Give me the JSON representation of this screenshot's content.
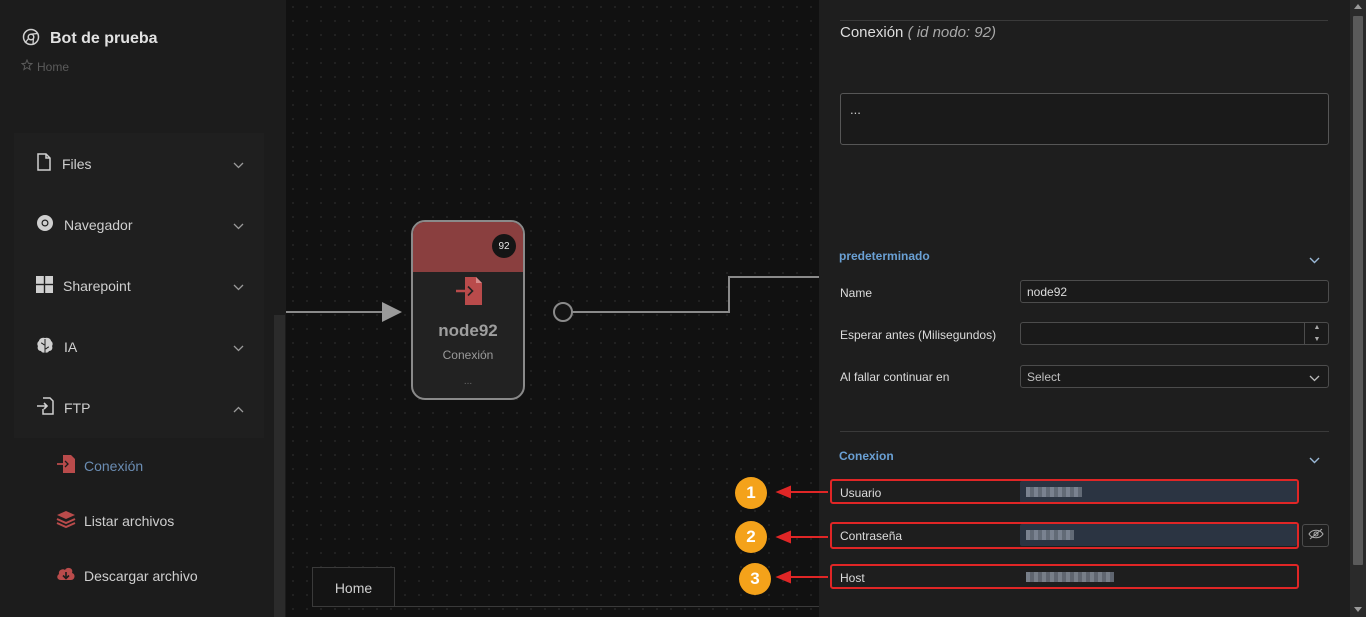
{
  "sidebar": {
    "brand": "Bot de prueba",
    "breadcrumb": "Home",
    "items": [
      {
        "label": "Files",
        "icon": "file-icon"
      },
      {
        "label": "Navegador",
        "icon": "chrome-icon"
      },
      {
        "label": "Sharepoint",
        "icon": "windows-icon"
      },
      {
        "label": "IA",
        "icon": "brain-icon"
      },
      {
        "label": "FTP",
        "icon": "login-icon"
      }
    ],
    "sub_items": [
      {
        "label": "Conexión",
        "icon": "login-icon",
        "active": true
      },
      {
        "label": "Listar archivos",
        "icon": "layers-icon"
      },
      {
        "label": "Descargar archivo",
        "icon": "cloud-download-icon"
      }
    ]
  },
  "canvas": {
    "node": {
      "badge": "92",
      "title": "node92",
      "subtitle": "Conexión",
      "dots": "..."
    },
    "tab": "Home"
  },
  "panel": {
    "title": "Conexión",
    "title_sub": "( id nodo: 92)",
    "description": "...",
    "sections": {
      "default": "predeterminado",
      "connection": "Conexion"
    },
    "fields": {
      "name_label": "Name",
      "name_value": "node92",
      "wait_label": "Esperar antes (Milisegundos)",
      "wait_value": "",
      "fail_label": "Al fallar continuar en",
      "fail_value": "Select",
      "user_label": "Usuario",
      "password_label": "Contraseña",
      "host_label": "Host"
    }
  },
  "annotations": [
    "1",
    "2",
    "3"
  ],
  "colors": {
    "accent": "#6aa0d4",
    "node_head": "#8a3f3f",
    "highlight": "#e02626",
    "badge": "#f4a21a"
  }
}
